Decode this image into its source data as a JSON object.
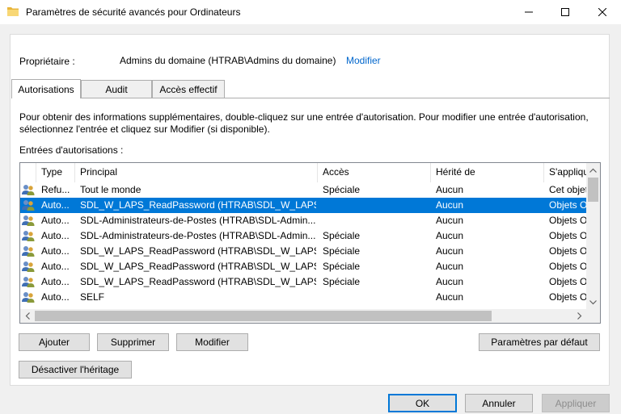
{
  "window": {
    "title": "Paramètres de sécurité avancés pour Ordinateurs",
    "icons": [
      "folder-icon",
      "minimize-icon",
      "maximize-icon",
      "close-icon"
    ]
  },
  "owner": {
    "label": "Propriétaire :",
    "value": "Admins du domaine (HTRAB\\Admins du domaine)",
    "change_link": "Modifier"
  },
  "tabs": [
    {
      "label": "Autorisations",
      "active": true
    },
    {
      "label": "Audit",
      "active": false
    },
    {
      "label": "Accès effectif",
      "active": false
    }
  ],
  "info_text": "Pour obtenir des informations supplémentaires, double-cliquez sur une entrée d'autorisation. Pour modifier une entrée d'autorisation, sélectionnez l'entrée et cliquez sur Modifier (si disponible).",
  "entries_label": "Entrées d'autorisations :",
  "columns": [
    "Type",
    "Principal",
    "Accès",
    "Hérité de",
    "S'appliqu"
  ],
  "rows": [
    {
      "type": "Refu...",
      "principal": "Tout le monde",
      "access": "Spéciale",
      "inherited": "Aucun",
      "applies": "Cet objet",
      "selected": false
    },
    {
      "type": "Auto...",
      "principal": "SDL_W_LAPS_ReadPassword (HTRAB\\SDL_W_LAPS_R...",
      "access": "",
      "inherited": "Aucun",
      "applies": "Objets O",
      "selected": true
    },
    {
      "type": "Auto...",
      "principal": "SDL-Administrateurs-de-Postes (HTRAB\\SDL-Admin...",
      "access": "",
      "inherited": "Aucun",
      "applies": "Objets O",
      "selected": false
    },
    {
      "type": "Auto...",
      "principal": "SDL-Administrateurs-de-Postes (HTRAB\\SDL-Admin...",
      "access": "Spéciale",
      "inherited": "Aucun",
      "applies": "Objets O",
      "selected": false
    },
    {
      "type": "Auto...",
      "principal": "SDL_W_LAPS_ReadPassword (HTRAB\\SDL_W_LAPS_R...",
      "access": "Spéciale",
      "inherited": "Aucun",
      "applies": "Objets O",
      "selected": false
    },
    {
      "type": "Auto...",
      "principal": "SDL_W_LAPS_ReadPassword (HTRAB\\SDL_W_LAPS_R...",
      "access": "Spéciale",
      "inherited": "Aucun",
      "applies": "Objets O",
      "selected": false
    },
    {
      "type": "Auto...",
      "principal": "SDL_W_LAPS_ReadPassword (HTRAB\\SDL_W_LAPS_R...",
      "access": "Spéciale",
      "inherited": "Aucun",
      "applies": "Objets O",
      "selected": false
    },
    {
      "type": "Auto...",
      "principal": "SELF",
      "access": "",
      "inherited": "Aucun",
      "applies": "Objets O",
      "selected": false
    }
  ],
  "buttons": {
    "add": "Ajouter",
    "remove": "Supprimer",
    "edit": "Modifier",
    "defaults": "Paramètres par défaut",
    "disable_inheritance": "Désactiver l'héritage",
    "ok": "OK",
    "cancel": "Annuler",
    "apply": "Appliquer"
  },
  "colors": {
    "selection": "#0078d7",
    "link": "#0066cc",
    "default_button_border": "#0078d7"
  }
}
